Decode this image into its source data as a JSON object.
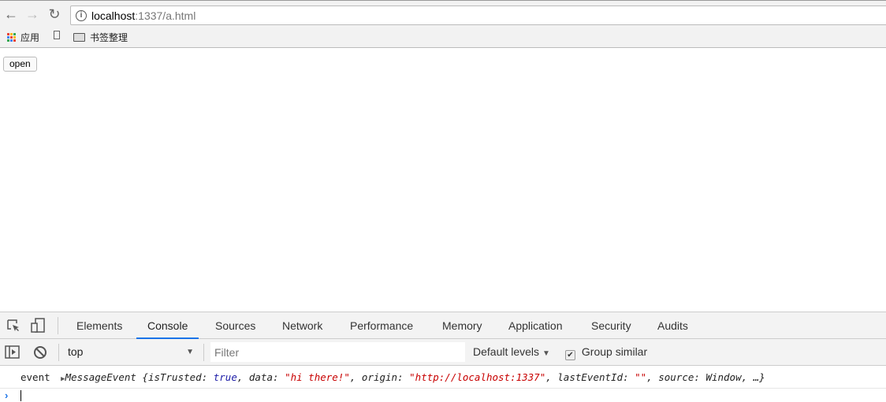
{
  "browser": {
    "url_host": "localhost",
    "url_rest": ":1337/a.html",
    "icons": {
      "back": "arrow-left-icon",
      "forward": "arrow-right-icon",
      "reload": "reload-icon",
      "info": "info-icon"
    },
    "bookmarks": [
      {
        "label": "应用",
        "icon": "apps-icon"
      },
      {
        "label": "",
        "icon": "file-icon"
      },
      {
        "label": "书签整理",
        "icon": "folder-icon"
      }
    ]
  },
  "page": {
    "open_button": "open"
  },
  "devtools": {
    "tabs": [
      "Elements",
      "Console",
      "Sources",
      "Network",
      "Performance",
      "Memory",
      "Application",
      "Security",
      "Audits"
    ],
    "active_tab": "Console",
    "context": "top",
    "filter_placeholder": "Filter",
    "levels": "Default levels",
    "group_similar": "Group similar",
    "group_similar_checked": true,
    "accent": "#1a73e8"
  },
  "console": {
    "label": "event",
    "class_name": "MessageEvent",
    "p1": " {isTrusted: ",
    "v1": "true",
    "p2": ", data: ",
    "v2": "\"hi there!\"",
    "p3": ", origin: ",
    "v3": "\"http://localhost:1337\"",
    "p4": ", lastEventId: ",
    "v4": "\"\"",
    "p5": ", source: Window, …}"
  }
}
